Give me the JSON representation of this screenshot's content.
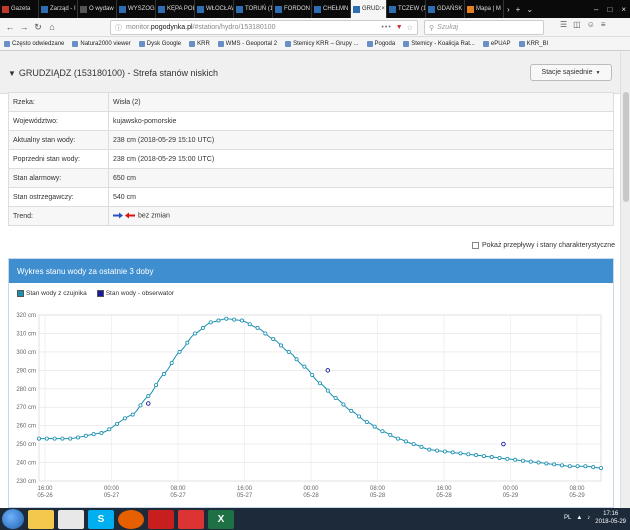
{
  "browser": {
    "tabs": [
      {
        "label": "Gazeta",
        "color": "#c0392b"
      },
      {
        "label": "Zarząd - I",
        "color": "#2e6db4"
      },
      {
        "label": "O wydaw",
        "color": "#555555"
      },
      {
        "label": "WYSZOGR",
        "color": "#2e6db4"
      },
      {
        "label": "KĘPA POL",
        "color": "#2e6db4"
      },
      {
        "label": "WŁOCŁAW",
        "color": "#2e6db4"
      },
      {
        "label": "TORUŃ (1",
        "color": "#2e6db4"
      },
      {
        "label": "FORDON",
        "color": "#2e6db4"
      },
      {
        "label": "CHEŁMN",
        "color": "#2e6db4"
      },
      {
        "label": "GRUD:",
        "color": "#2e6db4",
        "active": true
      },
      {
        "label": "TCZEW (1",
        "color": "#2e6db4"
      },
      {
        "label": "GDAŃSK",
        "color": "#2e6db4"
      },
      {
        "label": "Mapa | M",
        "color": "#e67e22"
      }
    ],
    "url_prefix": "monitor.",
    "url_domain": "pogodynka.pl",
    "url_path": "/#station/hydro/153180100",
    "url_dots": "•••",
    "search_placeholder": "Szukaj",
    "bookmarks": [
      "Często odwiedzane",
      "Natura2000 viewer",
      "Dysk Google",
      "KRR",
      "WMS - Geoportal 2",
      "Stemicy KRR – Grupy ...",
      "Pogoda",
      "Stemicy - Koalicja Rat...",
      "ePUAP",
      "KRR_BI"
    ]
  },
  "station": {
    "title": "GRUDZIĄDZ (153180100) - Strefa stanów niskich",
    "neighbors_button": "Stacje sąsiednie"
  },
  "info_rows": [
    {
      "label": "Rzeka:",
      "value": "Wisła (2)"
    },
    {
      "label": "Województwo:",
      "value": "kujawsko-pomorskie"
    },
    {
      "label": "Aktualny stan wody:",
      "value": "238 cm (2018-05-29 15:10 UTC)"
    },
    {
      "label": "Poprzedni stan wody:",
      "value": "238 cm (2018-05-29 15:00 UTC)"
    },
    {
      "label": "Stan alarmowy:",
      "value": "650 cm"
    },
    {
      "label": "Stan ostrzegawczy:",
      "value": "540 cm"
    },
    {
      "label": "Trend:",
      "value": "bez zmian"
    }
  ],
  "show_flows_label": "Pokaż przepływy i stany charakterystyczne",
  "chart_panel_title": "Wykres stanu wody za ostatnie 3 doby",
  "chart_data": {
    "type": "line",
    "legend": [
      "Stan wody z czujnika",
      "Stan wody - obserwator"
    ],
    "legend_colors": [
      "#1a8fb0",
      "#1a1aa0"
    ],
    "y_ticks": [
      "320 cm",
      "310 cm",
      "300 cm",
      "290 cm",
      "280 cm",
      "270 cm",
      "260 cm",
      "250 cm",
      "240 cm",
      "230 cm"
    ],
    "ylim": [
      230,
      320
    ],
    "x_ticks": [
      {
        "time": "16:00",
        "date": "05-26"
      },
      {
        "time": "00:00",
        "date": "05-27"
      },
      {
        "time": "08:00",
        "date": "05-27"
      },
      {
        "time": "16:00",
        "date": "05-27"
      },
      {
        "time": "00:00",
        "date": "05-28"
      },
      {
        "time": "08:00",
        "date": "05-28"
      },
      {
        "time": "16:00",
        "date": "05-28"
      },
      {
        "time": "00:00",
        "date": "05-29"
      },
      {
        "time": "08:00",
        "date": "05-29"
      }
    ],
    "xlim_hours": [
      0,
      72
    ],
    "sensor_series": {
      "name": "Stan wody z czujnika",
      "hours": [
        0,
        4,
        8,
        12,
        14,
        16,
        18,
        20,
        22,
        24,
        26,
        28,
        30,
        32,
        34,
        36,
        38,
        40,
        42,
        44,
        46,
        48,
        50,
        52,
        54,
        56,
        58,
        60,
        62,
        64,
        66,
        68,
        70,
        72
      ],
      "values": [
        253,
        253,
        256,
        266,
        276,
        288,
        300,
        310,
        316,
        318,
        317,
        313,
        307,
        300,
        292,
        283,
        275,
        268,
        262,
        257,
        253,
        250,
        247,
        246,
        245,
        244,
        243,
        242,
        241,
        240,
        239,
        238,
        238,
        237
      ]
    },
    "observer_series": {
      "name": "Stan wody - obserwator",
      "hours": [
        14,
        37,
        59.5
      ],
      "values": [
        272,
        290,
        250
      ]
    }
  },
  "taskbar": {
    "locale": "PL",
    "time": "17:16",
    "date": "2018-05-29"
  }
}
